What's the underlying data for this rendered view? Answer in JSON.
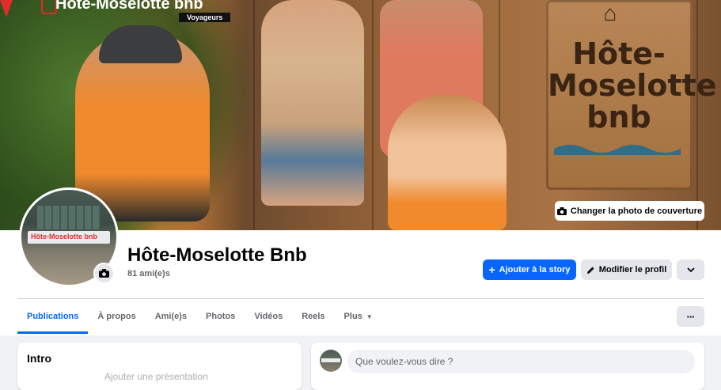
{
  "cover": {
    "brand_name": "Hôte-Moselotte bnb",
    "brand_tagline": "Voyageurs",
    "sign_text": "Hôte-\nMoselotte\nbnb",
    "change_cover_label": "Changer la photo de couverture"
  },
  "profile": {
    "name": "Hôte-Moselotte Bnb",
    "friends_count": "81 ami(e)s",
    "avatar_sign_text": "Hôte-Moselotte bnb"
  },
  "actions": {
    "add_story_label": "Ajouter à la story",
    "edit_profile_label": "Modifier le profil"
  },
  "tabs": [
    {
      "label": "Publications",
      "active": true
    },
    {
      "label": "À propos",
      "active": false
    },
    {
      "label": "Ami(e)s",
      "active": false
    },
    {
      "label": "Photos",
      "active": false
    },
    {
      "label": "Vidéos",
      "active": false
    },
    {
      "label": "Reels",
      "active": false
    },
    {
      "label": "Plus",
      "active": false
    }
  ],
  "more_options_label": "···",
  "intro": {
    "title": "Intro",
    "faded_text": "Ajouter une présentation"
  },
  "composer": {
    "placeholder": "Que voulez-vous dire ?"
  },
  "colors": {
    "primary": "#0866ff",
    "page_bg": "#f0f2f5",
    "button_gray": "#e4e6eb",
    "secondary_text": "#65676b"
  }
}
